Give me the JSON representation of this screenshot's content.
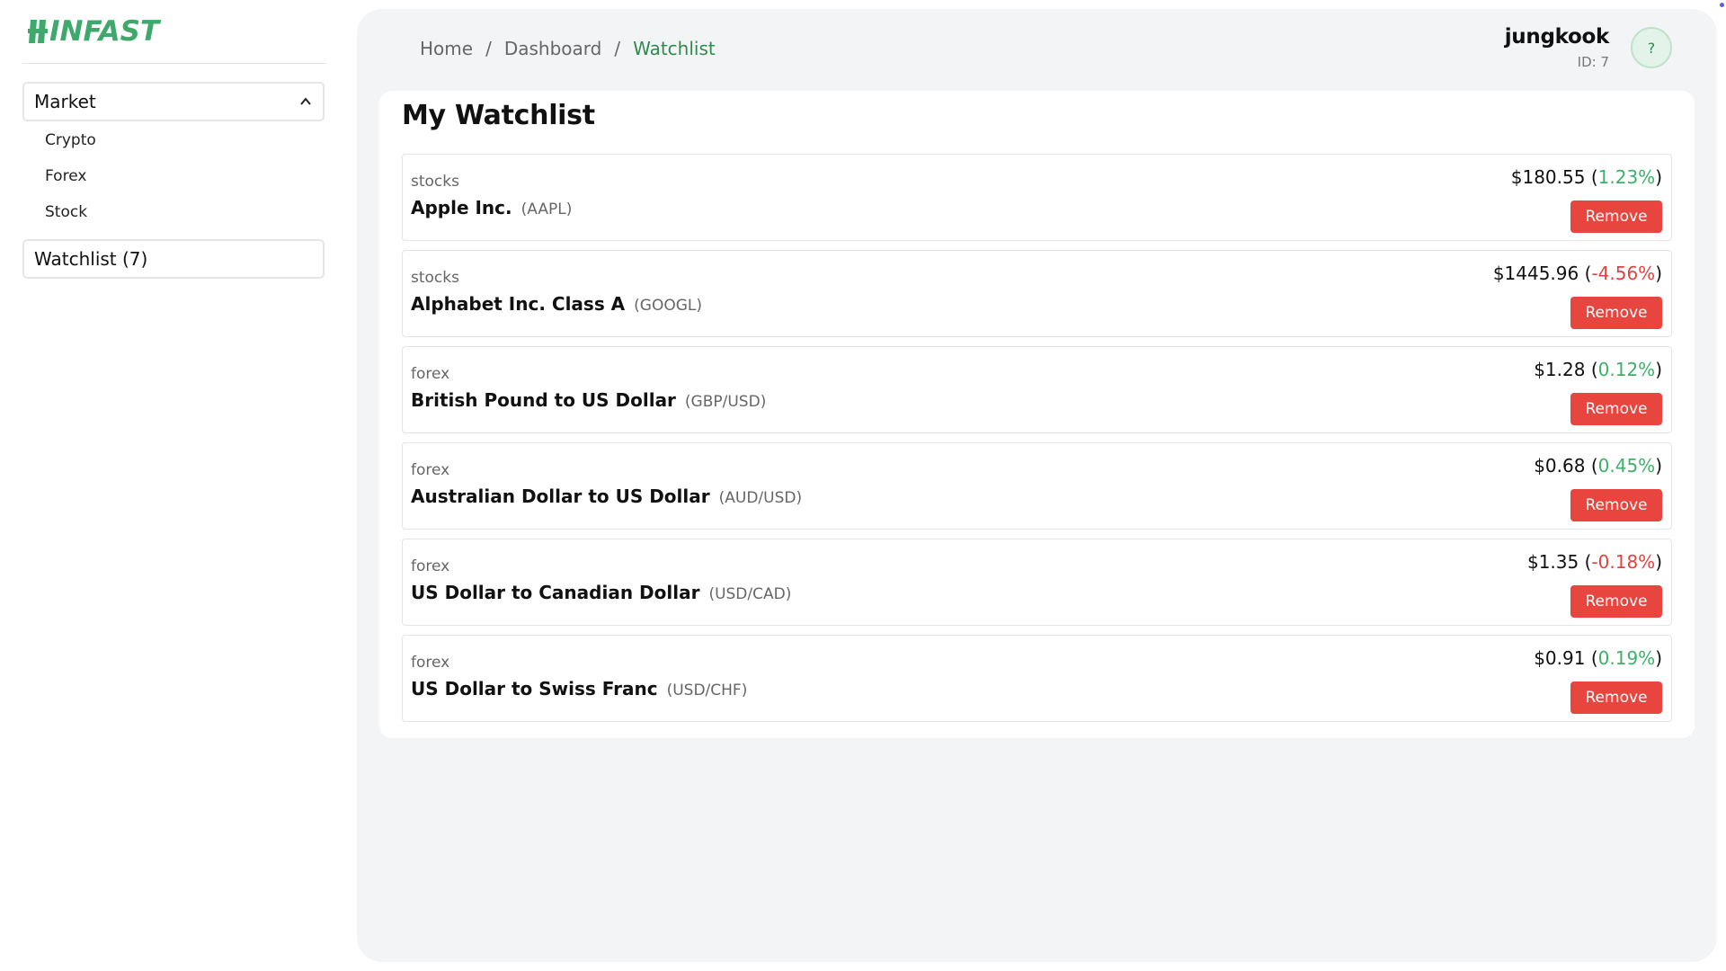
{
  "app": {
    "logo_text": "INFAST",
    "brand_color": "#3fa86b"
  },
  "sidebar": {
    "market_label": "Market",
    "market_icon": "chevron-up-icon",
    "market_items": [
      "Crypto",
      "Forex",
      "Stock"
    ],
    "watchlist_label": "Watchlist (7)"
  },
  "breadcrumb": {
    "home": "Home",
    "dashboard": "Dashboard",
    "current": "Watchlist",
    "separator": "/"
  },
  "user": {
    "name": "jungkook",
    "id_label": "ID: 7",
    "avatar_text": "?"
  },
  "main": {
    "title": "My Watchlist",
    "remove_label": "Remove",
    "items": [
      {
        "category": "stocks",
        "name": "Apple Inc.",
        "symbol": "(AAPL)",
        "price": "$180.55",
        "change": "1.23%",
        "direction": "up"
      },
      {
        "category": "stocks",
        "name": "Alphabet Inc. Class A",
        "symbol": "(GOOGL)",
        "price": "$1445.96",
        "change": "-4.56%",
        "direction": "down"
      },
      {
        "category": "forex",
        "name": "British Pound to US Dollar",
        "symbol": "(GBP/USD)",
        "price": "$1.28",
        "change": "0.12%",
        "direction": "up"
      },
      {
        "category": "forex",
        "name": "Australian Dollar to US Dollar",
        "symbol": "(AUD/USD)",
        "price": "$0.68",
        "change": "0.45%",
        "direction": "up"
      },
      {
        "category": "forex",
        "name": "US Dollar to Canadian Dollar",
        "symbol": "(USD/CAD)",
        "price": "$1.35",
        "change": "-0.18%",
        "direction": "down"
      },
      {
        "category": "forex",
        "name": "US Dollar to Swiss Franc",
        "symbol": "(USD/CHF)",
        "price": "$0.91",
        "change": "0.19%",
        "direction": "up"
      }
    ]
  },
  "colors": {
    "positive": "#3fb06a",
    "negative": "#e2423f",
    "remove_button": "#e8453f",
    "active_crumb": "#2f8a4d"
  }
}
